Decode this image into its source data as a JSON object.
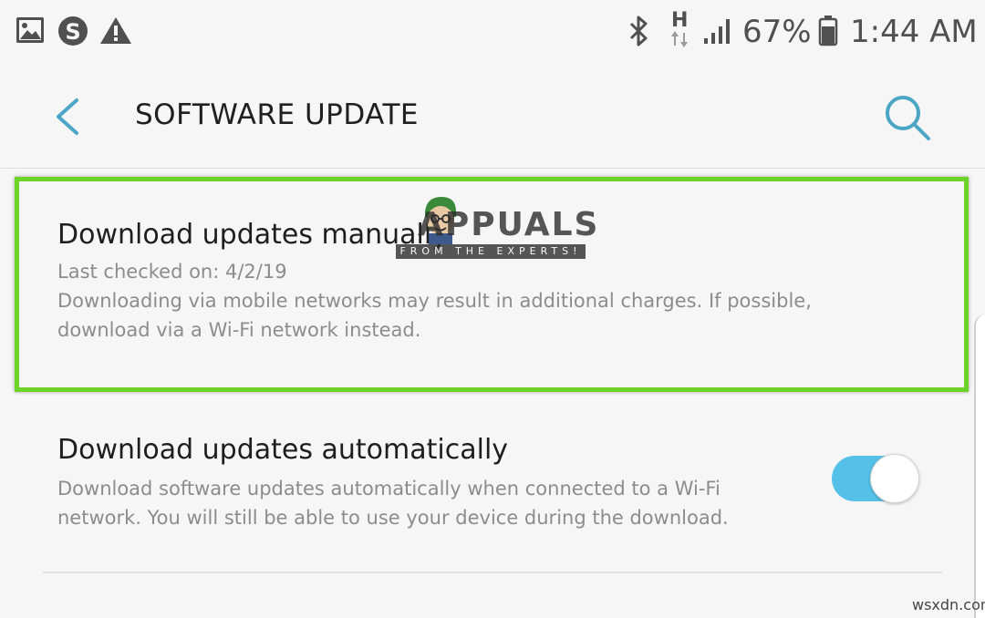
{
  "status_bar": {
    "icons_left": [
      "gallery-icon",
      "skype-icon",
      "warning-icon"
    ],
    "network_type": "H",
    "battery_percent": "67%",
    "time": "1:44 AM"
  },
  "app_bar": {
    "title": "SOFTWARE UPDATE"
  },
  "items": [
    {
      "title": "Download updates manually",
      "last_checked": "Last checked on: 4/2/19",
      "description": "Downloading via mobile networks may result in additional charges. If possible, download via a Wi-Fi network instead."
    },
    {
      "title": "Download updates automatically",
      "description": "Download software updates automatically when connected to a Wi-Fi network. You will still be able to use your device during the download.",
      "toggle_on": true
    }
  ],
  "watermark": {
    "brand": "APPUALS",
    "tagline": "FROM THE EXPERTS!",
    "site": "wsxdn.com"
  },
  "colors": {
    "accent": "#56c1e8",
    "highlight": "#6ed327",
    "icon_teal": "#4aa6c4",
    "text_primary": "#1e1e1e",
    "text_secondary": "#8c8c8c",
    "background": "#f6f6f6"
  }
}
